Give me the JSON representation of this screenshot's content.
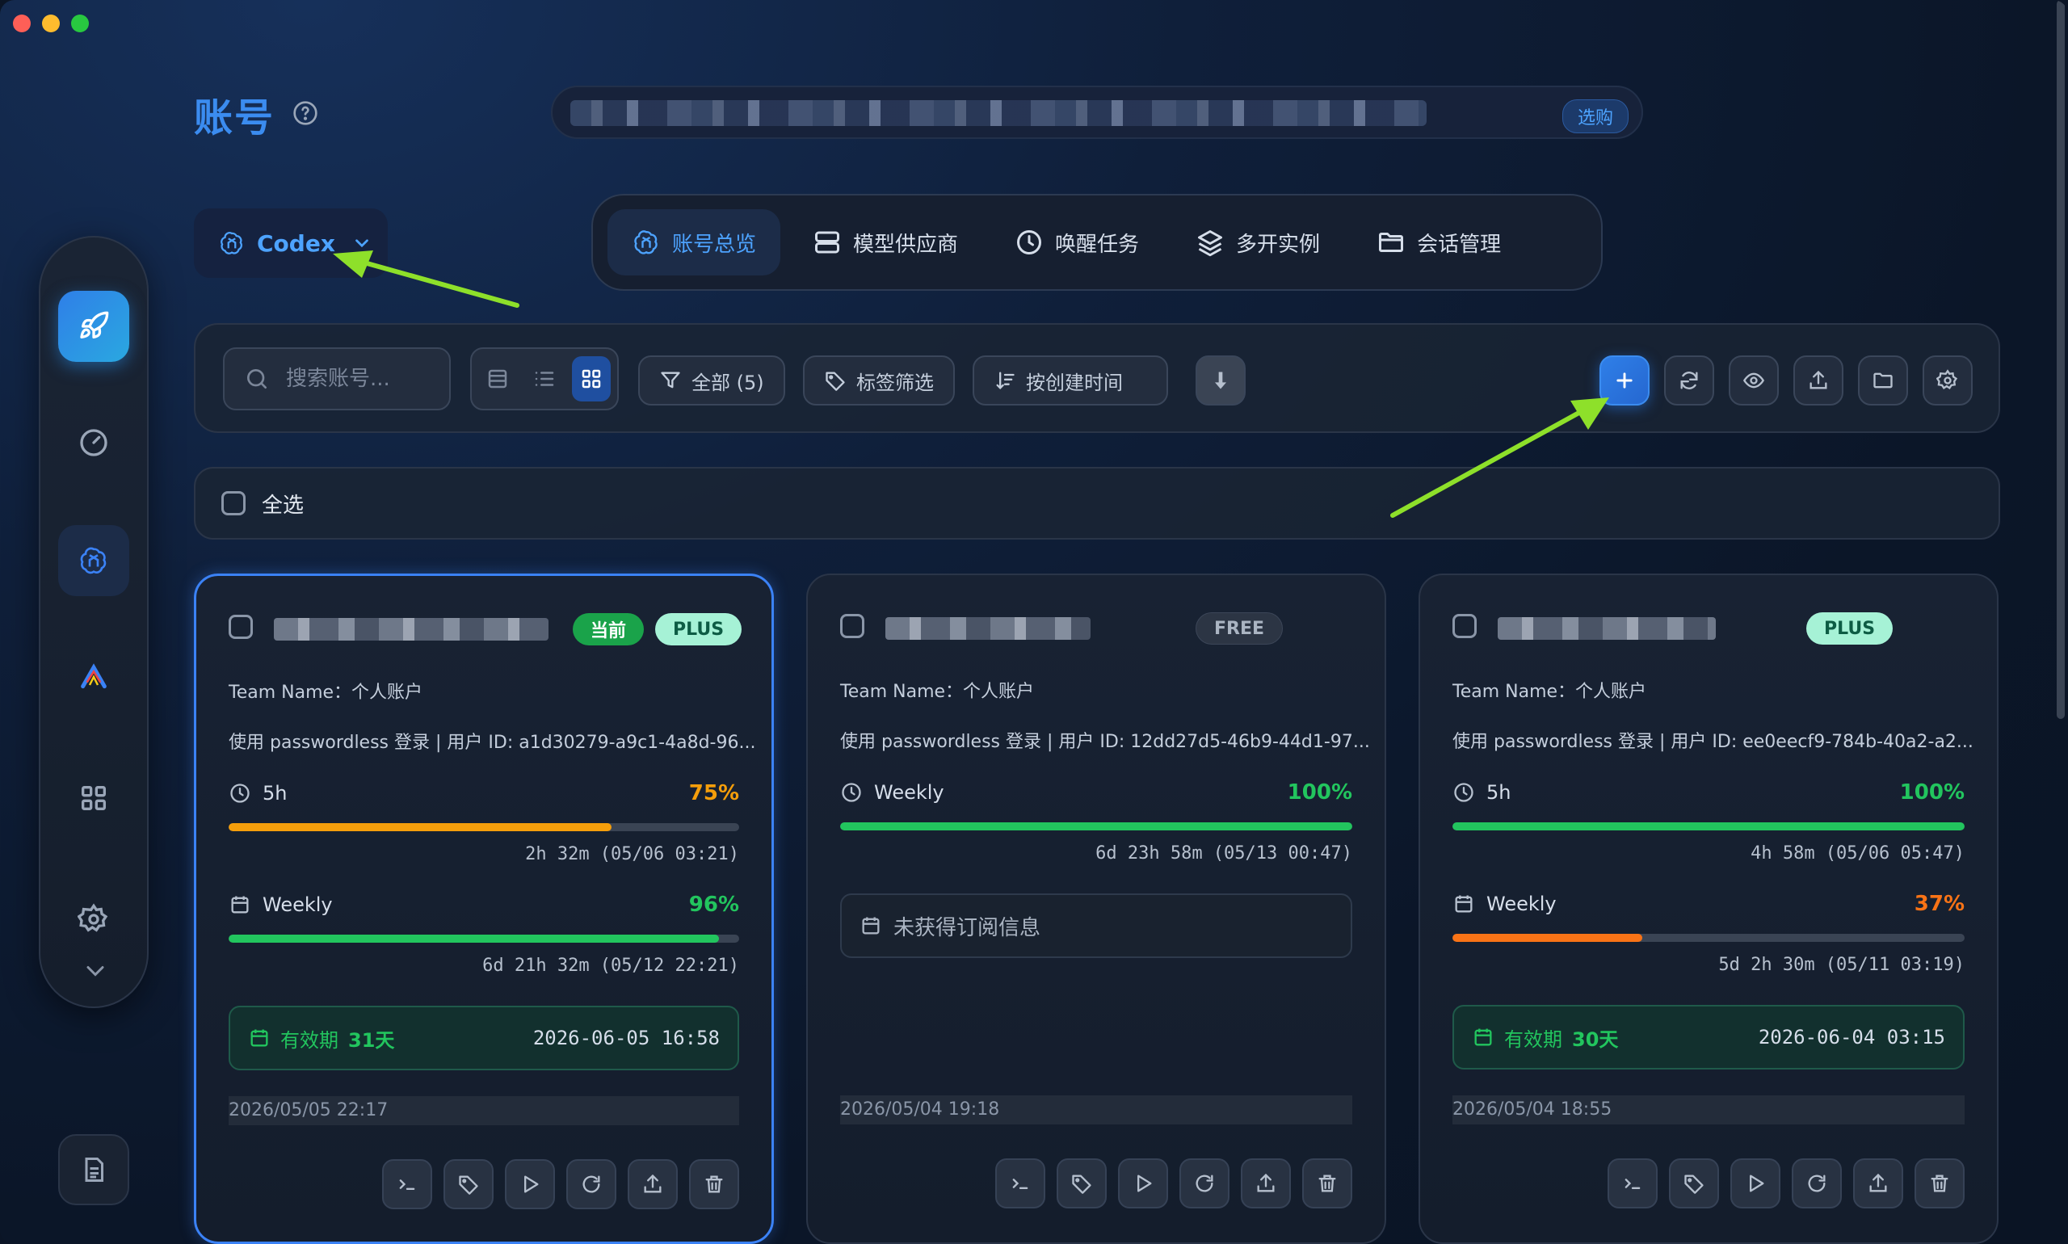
{
  "page": {
    "title": "账号"
  },
  "banner": {
    "badge": "选购"
  },
  "provider": {
    "label": "Codex"
  },
  "tabs": [
    {
      "label": "账号总览",
      "icon": "openai-icon"
    },
    {
      "label": "模型供应商",
      "icon": "server-icon"
    },
    {
      "label": "唤醒任务",
      "icon": "clock-icon"
    },
    {
      "label": "多开实例",
      "icon": "layers-icon"
    },
    {
      "label": "会话管理",
      "icon": "folder-icon"
    }
  ],
  "toolbar": {
    "search_placeholder": "搜索账号...",
    "filter_all": "全部 (5)",
    "tag_filter": "标签筛选",
    "sort": "按创建时间"
  },
  "select_all": "全选",
  "cards": [
    {
      "current_badge": "当前",
      "plan": "PLUS",
      "team": "Team Name：个人账户",
      "login": "使用 passwordless 登录 | 用户 ID: a1d30279-a9c1-4a8d-96...",
      "q1_label": "5h",
      "q1_pct": "75%",
      "q1_value": 0.75,
      "q1_reset": "2h 32m (05/06 03:21)",
      "q2_label": "Weekly",
      "q2_pct": "96%",
      "q2_value": 0.96,
      "q2_reset": "6d 21h 32m (05/12 22:21)",
      "validity_label": "有效期",
      "validity_days": "31天",
      "validity_date": "2026-06-05 16:58",
      "created": "2026/05/05 22:17"
    },
    {
      "plan": "FREE",
      "team": "Team Name：个人账户",
      "login": "使用 passwordless 登录 | 用户 ID: 12dd27d5-46b9-44d1-97...",
      "q1_label": "Weekly",
      "q1_pct": "100%",
      "q1_value": 1.0,
      "q1_reset": "6d 23h 58m (05/13 00:47)",
      "nosub": "未获得订阅信息",
      "created": "2026/05/04 19:18"
    },
    {
      "plan": "PLUS",
      "team": "Team Name：个人账户",
      "login": "使用 passwordless 登录 | 用户 ID: ee0eecf9-784b-40a2-a2...",
      "q1_label": "5h",
      "q1_pct": "100%",
      "q1_value": 1.0,
      "q1_reset": "4h 58m (05/06 05:47)",
      "q2_label": "Weekly",
      "q2_pct": "37%",
      "q2_value": 0.37,
      "q2_reset": "5d 2h 30m (05/11 03:19)",
      "validity_label": "有效期",
      "validity_days": "30天",
      "validity_date": "2026-06-04 03:15",
      "created": "2026/05/04 18:55"
    }
  ],
  "colors": {
    "accent": "#3b82f6",
    "green": "#22c55e",
    "orange": "#f59e0b",
    "red_orange": "#f97316",
    "annotation": "#8ee02a"
  }
}
